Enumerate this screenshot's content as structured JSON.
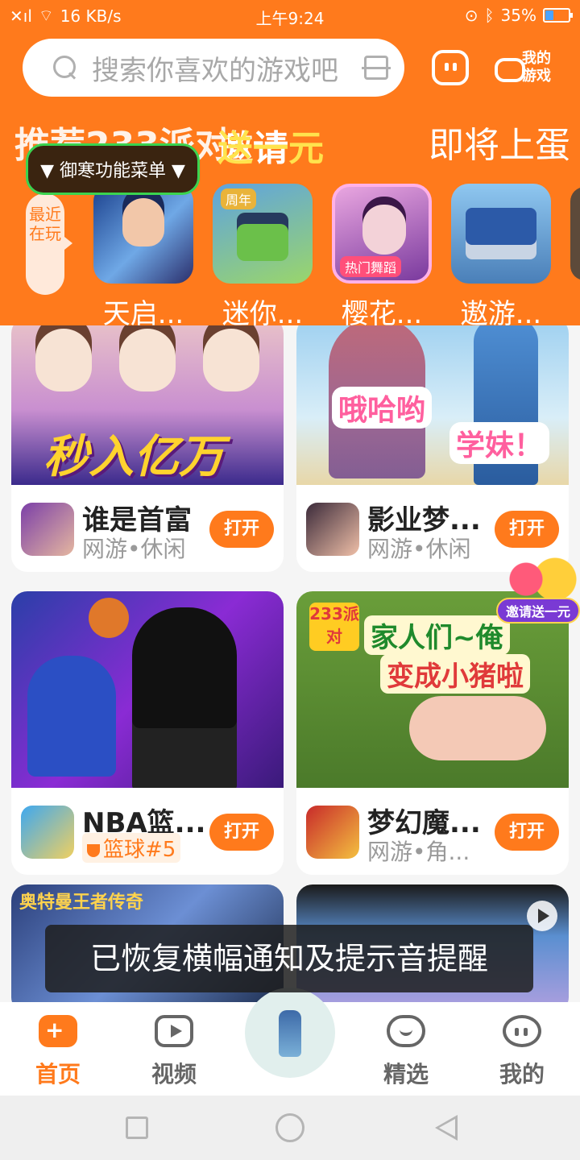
{
  "status_bar": {
    "signal": "✕ıl",
    "network_speed": "16 KB/s",
    "time": "上午9:24",
    "battery": "35%",
    "battery_level": 0.35
  },
  "header": {
    "search_placeholder": "搜索你喜欢的游戏吧",
    "my_games_label": "我的游戏",
    "banners": [
      "推荐233派对",
      "邀请",
      "送一元",
      "即将上蛋"
    ],
    "function_menu": "▼ 御寒功能菜单 ▼",
    "recent_label": "最近在玩"
  },
  "recent_games": [
    {
      "name": "天启...",
      "tag": ""
    },
    {
      "name": "迷你...",
      "tag": "周年"
    },
    {
      "name": "樱花...",
      "tag": "热门舞蹈"
    },
    {
      "name": "遨游...",
      "tag": ""
    }
  ],
  "cards": [
    {
      "art_text": "秒入亿万",
      "title": "谁是首富",
      "sub": "网游•休闲",
      "button": "打开"
    },
    {
      "art_text": "哦哈哟",
      "art_text2": "学妹！",
      "title": "影业梦...",
      "sub": "网游•休闲",
      "button": "打开"
    },
    {
      "title": "NBA篮...",
      "sub": "篮球#5",
      "button": "打开"
    },
    {
      "art_badge": "233派对",
      "art_text": "家人们~俺",
      "art_text2": "变成小猪啦",
      "title": "梦幻魔...",
      "sub": "网游•角...",
      "button": "打开"
    },
    {
      "art_text": "奥特曼王者传奇"
    },
    {}
  ],
  "invite_float": "邀请送一元",
  "toast": "已恢复横幅通知及提示音提醒",
  "bottom_nav": [
    {
      "label": "首页",
      "icon": "gamepad-icon",
      "active": true
    },
    {
      "label": "视频",
      "icon": "video-icon",
      "active": false
    },
    {
      "label": "精选",
      "icon": "heart-icon",
      "active": false
    },
    {
      "label": "我的",
      "icon": "smile-icon",
      "active": false
    }
  ],
  "colors": {
    "accent": "#ff7a1c"
  }
}
